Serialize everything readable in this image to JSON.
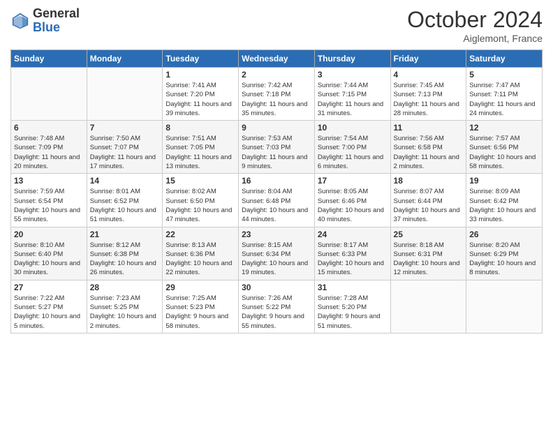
{
  "logo": {
    "general": "General",
    "blue": "Blue"
  },
  "title": "October 2024",
  "location": "Aiglemont, France",
  "days_of_week": [
    "Sunday",
    "Monday",
    "Tuesday",
    "Wednesday",
    "Thursday",
    "Friday",
    "Saturday"
  ],
  "weeks": [
    [
      {
        "day": "",
        "info": ""
      },
      {
        "day": "",
        "info": ""
      },
      {
        "day": "1",
        "info": "Sunrise: 7:41 AM\nSunset: 7:20 PM\nDaylight: 11 hours and 39 minutes."
      },
      {
        "day": "2",
        "info": "Sunrise: 7:42 AM\nSunset: 7:18 PM\nDaylight: 11 hours and 35 minutes."
      },
      {
        "day": "3",
        "info": "Sunrise: 7:44 AM\nSunset: 7:15 PM\nDaylight: 11 hours and 31 minutes."
      },
      {
        "day": "4",
        "info": "Sunrise: 7:45 AM\nSunset: 7:13 PM\nDaylight: 11 hours and 28 minutes."
      },
      {
        "day": "5",
        "info": "Sunrise: 7:47 AM\nSunset: 7:11 PM\nDaylight: 11 hours and 24 minutes."
      }
    ],
    [
      {
        "day": "6",
        "info": "Sunrise: 7:48 AM\nSunset: 7:09 PM\nDaylight: 11 hours and 20 minutes."
      },
      {
        "day": "7",
        "info": "Sunrise: 7:50 AM\nSunset: 7:07 PM\nDaylight: 11 hours and 17 minutes."
      },
      {
        "day": "8",
        "info": "Sunrise: 7:51 AM\nSunset: 7:05 PM\nDaylight: 11 hours and 13 minutes."
      },
      {
        "day": "9",
        "info": "Sunrise: 7:53 AM\nSunset: 7:03 PM\nDaylight: 11 hours and 9 minutes."
      },
      {
        "day": "10",
        "info": "Sunrise: 7:54 AM\nSunset: 7:00 PM\nDaylight: 11 hours and 6 minutes."
      },
      {
        "day": "11",
        "info": "Sunrise: 7:56 AM\nSunset: 6:58 PM\nDaylight: 11 hours and 2 minutes."
      },
      {
        "day": "12",
        "info": "Sunrise: 7:57 AM\nSunset: 6:56 PM\nDaylight: 10 hours and 58 minutes."
      }
    ],
    [
      {
        "day": "13",
        "info": "Sunrise: 7:59 AM\nSunset: 6:54 PM\nDaylight: 10 hours and 55 minutes."
      },
      {
        "day": "14",
        "info": "Sunrise: 8:01 AM\nSunset: 6:52 PM\nDaylight: 10 hours and 51 minutes."
      },
      {
        "day": "15",
        "info": "Sunrise: 8:02 AM\nSunset: 6:50 PM\nDaylight: 10 hours and 47 minutes."
      },
      {
        "day": "16",
        "info": "Sunrise: 8:04 AM\nSunset: 6:48 PM\nDaylight: 10 hours and 44 minutes."
      },
      {
        "day": "17",
        "info": "Sunrise: 8:05 AM\nSunset: 6:46 PM\nDaylight: 10 hours and 40 minutes."
      },
      {
        "day": "18",
        "info": "Sunrise: 8:07 AM\nSunset: 6:44 PM\nDaylight: 10 hours and 37 minutes."
      },
      {
        "day": "19",
        "info": "Sunrise: 8:09 AM\nSunset: 6:42 PM\nDaylight: 10 hours and 33 minutes."
      }
    ],
    [
      {
        "day": "20",
        "info": "Sunrise: 8:10 AM\nSunset: 6:40 PM\nDaylight: 10 hours and 30 minutes."
      },
      {
        "day": "21",
        "info": "Sunrise: 8:12 AM\nSunset: 6:38 PM\nDaylight: 10 hours and 26 minutes."
      },
      {
        "day": "22",
        "info": "Sunrise: 8:13 AM\nSunset: 6:36 PM\nDaylight: 10 hours and 22 minutes."
      },
      {
        "day": "23",
        "info": "Sunrise: 8:15 AM\nSunset: 6:34 PM\nDaylight: 10 hours and 19 minutes."
      },
      {
        "day": "24",
        "info": "Sunrise: 8:17 AM\nSunset: 6:33 PM\nDaylight: 10 hours and 15 minutes."
      },
      {
        "day": "25",
        "info": "Sunrise: 8:18 AM\nSunset: 6:31 PM\nDaylight: 10 hours and 12 minutes."
      },
      {
        "day": "26",
        "info": "Sunrise: 8:20 AM\nSunset: 6:29 PM\nDaylight: 10 hours and 8 minutes."
      }
    ],
    [
      {
        "day": "27",
        "info": "Sunrise: 7:22 AM\nSunset: 5:27 PM\nDaylight: 10 hours and 5 minutes."
      },
      {
        "day": "28",
        "info": "Sunrise: 7:23 AM\nSunset: 5:25 PM\nDaylight: 10 hours and 2 minutes."
      },
      {
        "day": "29",
        "info": "Sunrise: 7:25 AM\nSunset: 5:23 PM\nDaylight: 9 hours and 58 minutes."
      },
      {
        "day": "30",
        "info": "Sunrise: 7:26 AM\nSunset: 5:22 PM\nDaylight: 9 hours and 55 minutes."
      },
      {
        "day": "31",
        "info": "Sunrise: 7:28 AM\nSunset: 5:20 PM\nDaylight: 9 hours and 51 minutes."
      },
      {
        "day": "",
        "info": ""
      },
      {
        "day": "",
        "info": ""
      }
    ]
  ]
}
